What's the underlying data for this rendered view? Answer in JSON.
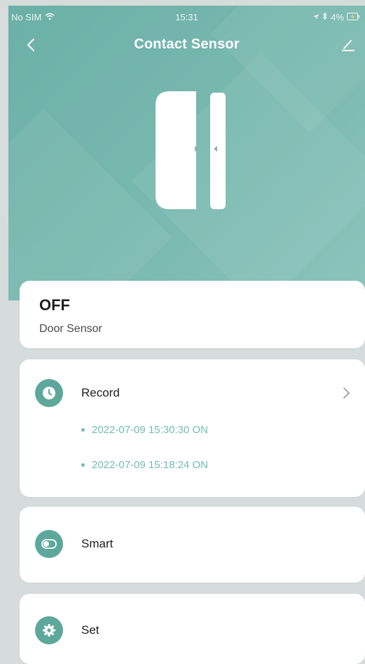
{
  "status_bar": {
    "carrier": "No SIM",
    "time": "15:31",
    "battery": "4%"
  },
  "nav": {
    "title": "Contact Sensor"
  },
  "device": {
    "state": "OFF",
    "type": "Door Sensor"
  },
  "record": {
    "label": "Record",
    "entries": [
      "2022-07-09 15:30:30 ON",
      "2022-07-09 15:18:24 ON"
    ]
  },
  "smart": {
    "label": "Smart"
  },
  "set": {
    "label": "Set"
  },
  "colors": {
    "header": "#79b9b0",
    "accent": "#5da89b",
    "record_text": "#72bdb0",
    "background": "#d5dcdb"
  }
}
